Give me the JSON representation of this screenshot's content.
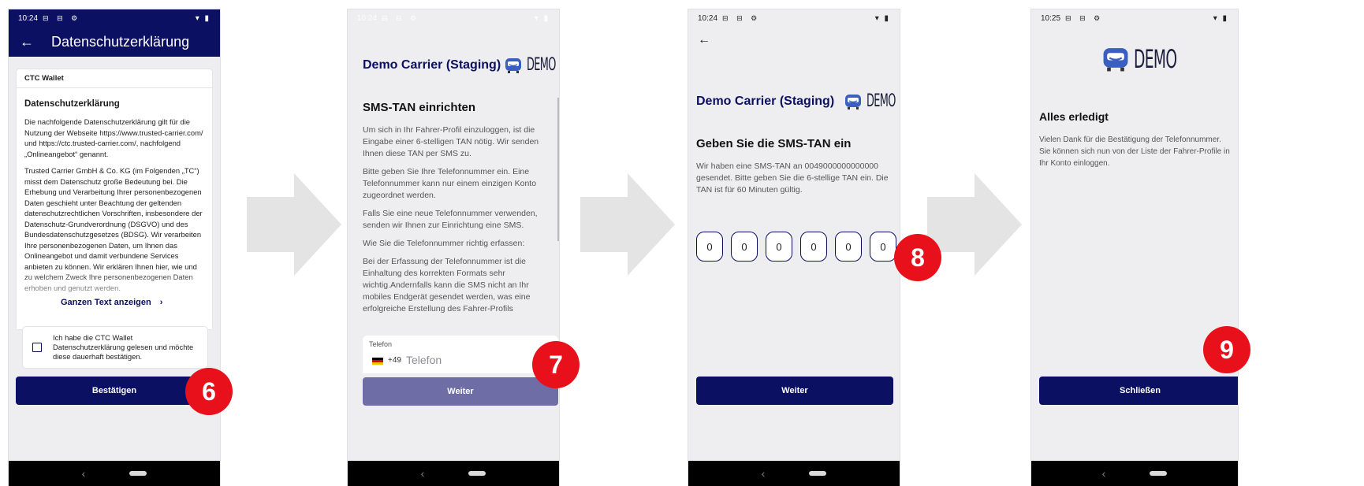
{
  "colors": {
    "primary": "#0c1062",
    "badge": "#e8101a",
    "arrow": "#e4e4e4"
  },
  "screen1": {
    "time": "10:24",
    "status_icons": "▾ ▮",
    "appbar_title": "Datenschutzerklärung",
    "card_header": "CTC Wallet",
    "section_title": "Datenschutzerklärung",
    "para1": "Die nachfolgende Datenschutzerklärung gilt für die Nutzung der Webseite https://www.trusted-carrier.com/ und https://ctc.trusted-carrier.com/, nachfolgend „Onlineangebot“ genannt.",
    "para2": "Trusted Carrier GmbH & Co. KG (im Folgenden „TC“) misst dem Datenschutz große Bedeutung bei. Die Erhebung und Verarbeitung Ihrer personenbezogenen Daten geschieht unter Beachtung der geltenden datenschutzrechtlichen Vorschriften, insbesondere der Datenschutz-Grundverordnung (DSGVO) und des Bundesdatenschutzgesetzes (BDSG). Wir verarbeiten Ihre personenbezogenen Daten, um Ihnen das Onlineangebot und damit verbundene Services anbieten zu können. Wir erklären Ihnen hier, wie und zu welchem Zweck Ihre personenbezogenen Daten erhoben und genutzt werden.",
    "show_full_text": "Ganzen Text anzeigen",
    "checkbox_label": "Ich habe die CTC Wallet Datenschutzerklärung gelesen und möchte diese dauerhaft bestätigen.",
    "confirm_button": "Bestätigen",
    "badge": "6"
  },
  "screen2": {
    "time": "10:24",
    "carrier": "Demo Carrier (Staging)",
    "logo_text": "DEMO",
    "title": "SMS-TAN einrichten",
    "p1": "Um sich in Ihr Fahrer-Profil einzuloggen, ist die Eingabe einer 6-stelligen TAN nötig. Wir senden Ihnen diese TAN per SMS zu.",
    "p2": "Bitte geben Sie Ihre Telefonnummer ein. Eine Telefonnummer kann nur einem einzigen Konto zugeordnet werden.",
    "p3": "Falls Sie eine neue Telefonnummer verwenden, senden wir Ihnen zur Einrichtung eine SMS.",
    "p4": "Wie Sie die Telefonnummer richtig erfassen:",
    "p5": "Bei der Erfassung der Telefonnummer ist die Einhaltung des korrekten Formats sehr wichtig.Andernfalls kann die SMS nicht an Ihr mobiles Endgerät gesendet werden, was eine erfolgreiche Erstellung des Fahrer-Profils",
    "phone_label": "Telefon",
    "country_code": "+49",
    "phone_placeholder": "Telefon",
    "next_button": "Weiter",
    "badge": "7"
  },
  "screen3": {
    "time": "10:24",
    "carrier": "Demo Carrier (Staging)",
    "logo_text": "DEMO",
    "title": "Geben Sie die SMS-TAN ein",
    "body": "Wir haben eine SMS-TAN an 0049000000000000 gesendet. Bitte geben Sie die 6-stellige TAN ein. Die TAN ist für 60 Minuten gültig.",
    "tan_digits": [
      "0",
      "0",
      "0",
      "0",
      "0",
      "0"
    ],
    "next_button": "Weiter",
    "badge": "8"
  },
  "screen4": {
    "time": "10:25",
    "logo_text": "DEMO",
    "title": "Alles erledigt",
    "body": "Vielen Dank für die Bestätigung der Telefonnummer. Sie können sich nun von der Liste der Fahrer-Profile in Ihr Konto einloggen.",
    "close_button": "Schließen",
    "badge": "9"
  }
}
